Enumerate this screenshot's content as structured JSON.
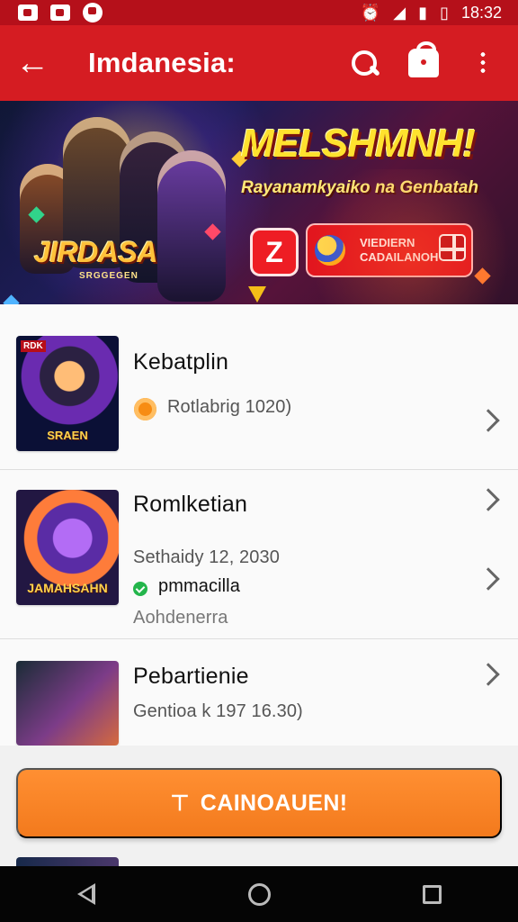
{
  "status": {
    "time": "18:32",
    "left_icons": [
      "gallery-icon",
      "message-icon",
      "media-icon"
    ],
    "right_icons": [
      "alarm-icon",
      "wifi-icon",
      "signal-icon",
      "battery-icon"
    ]
  },
  "appbar": {
    "title": "Imdanesia:",
    "actions": [
      "search-icon",
      "bag-icon",
      "more-icon"
    ]
  },
  "banner": {
    "headline": "MELSHMNH!",
    "subline": "Rayanamkyaiko na Genbatah",
    "logo": "JIRDASA",
    "logo_sub": "SRGGEGEN",
    "badge": "Z",
    "promo": "VIEDIERN\nCADAILANOH"
  },
  "items": [
    {
      "title": "Kebatplin",
      "meta": "Rotlabrig 1020)",
      "thumb_top": "RDK",
      "thumb_label": "SRAEN"
    },
    {
      "title": "Romlketian",
      "meta": "Sethaidy 12, 2030",
      "status": "pmmacilla",
      "category": "Aohdenerra",
      "thumb_label": "JAMAHSAHN"
    },
    {
      "title": "Pebartienie",
      "meta": "Gentioa k 197 16.30)",
      "thumb_label": ""
    }
  ],
  "cta": {
    "label": "CAINOAUEN!",
    "icon": "filter-icon"
  },
  "navigation": {
    "buttons": [
      "back-icon",
      "home-icon",
      "recent-apps-icon"
    ]
  },
  "colors": {
    "primary": "#d51c22",
    "status_bar": "#b5101a",
    "cta": "#ff8a2a"
  }
}
